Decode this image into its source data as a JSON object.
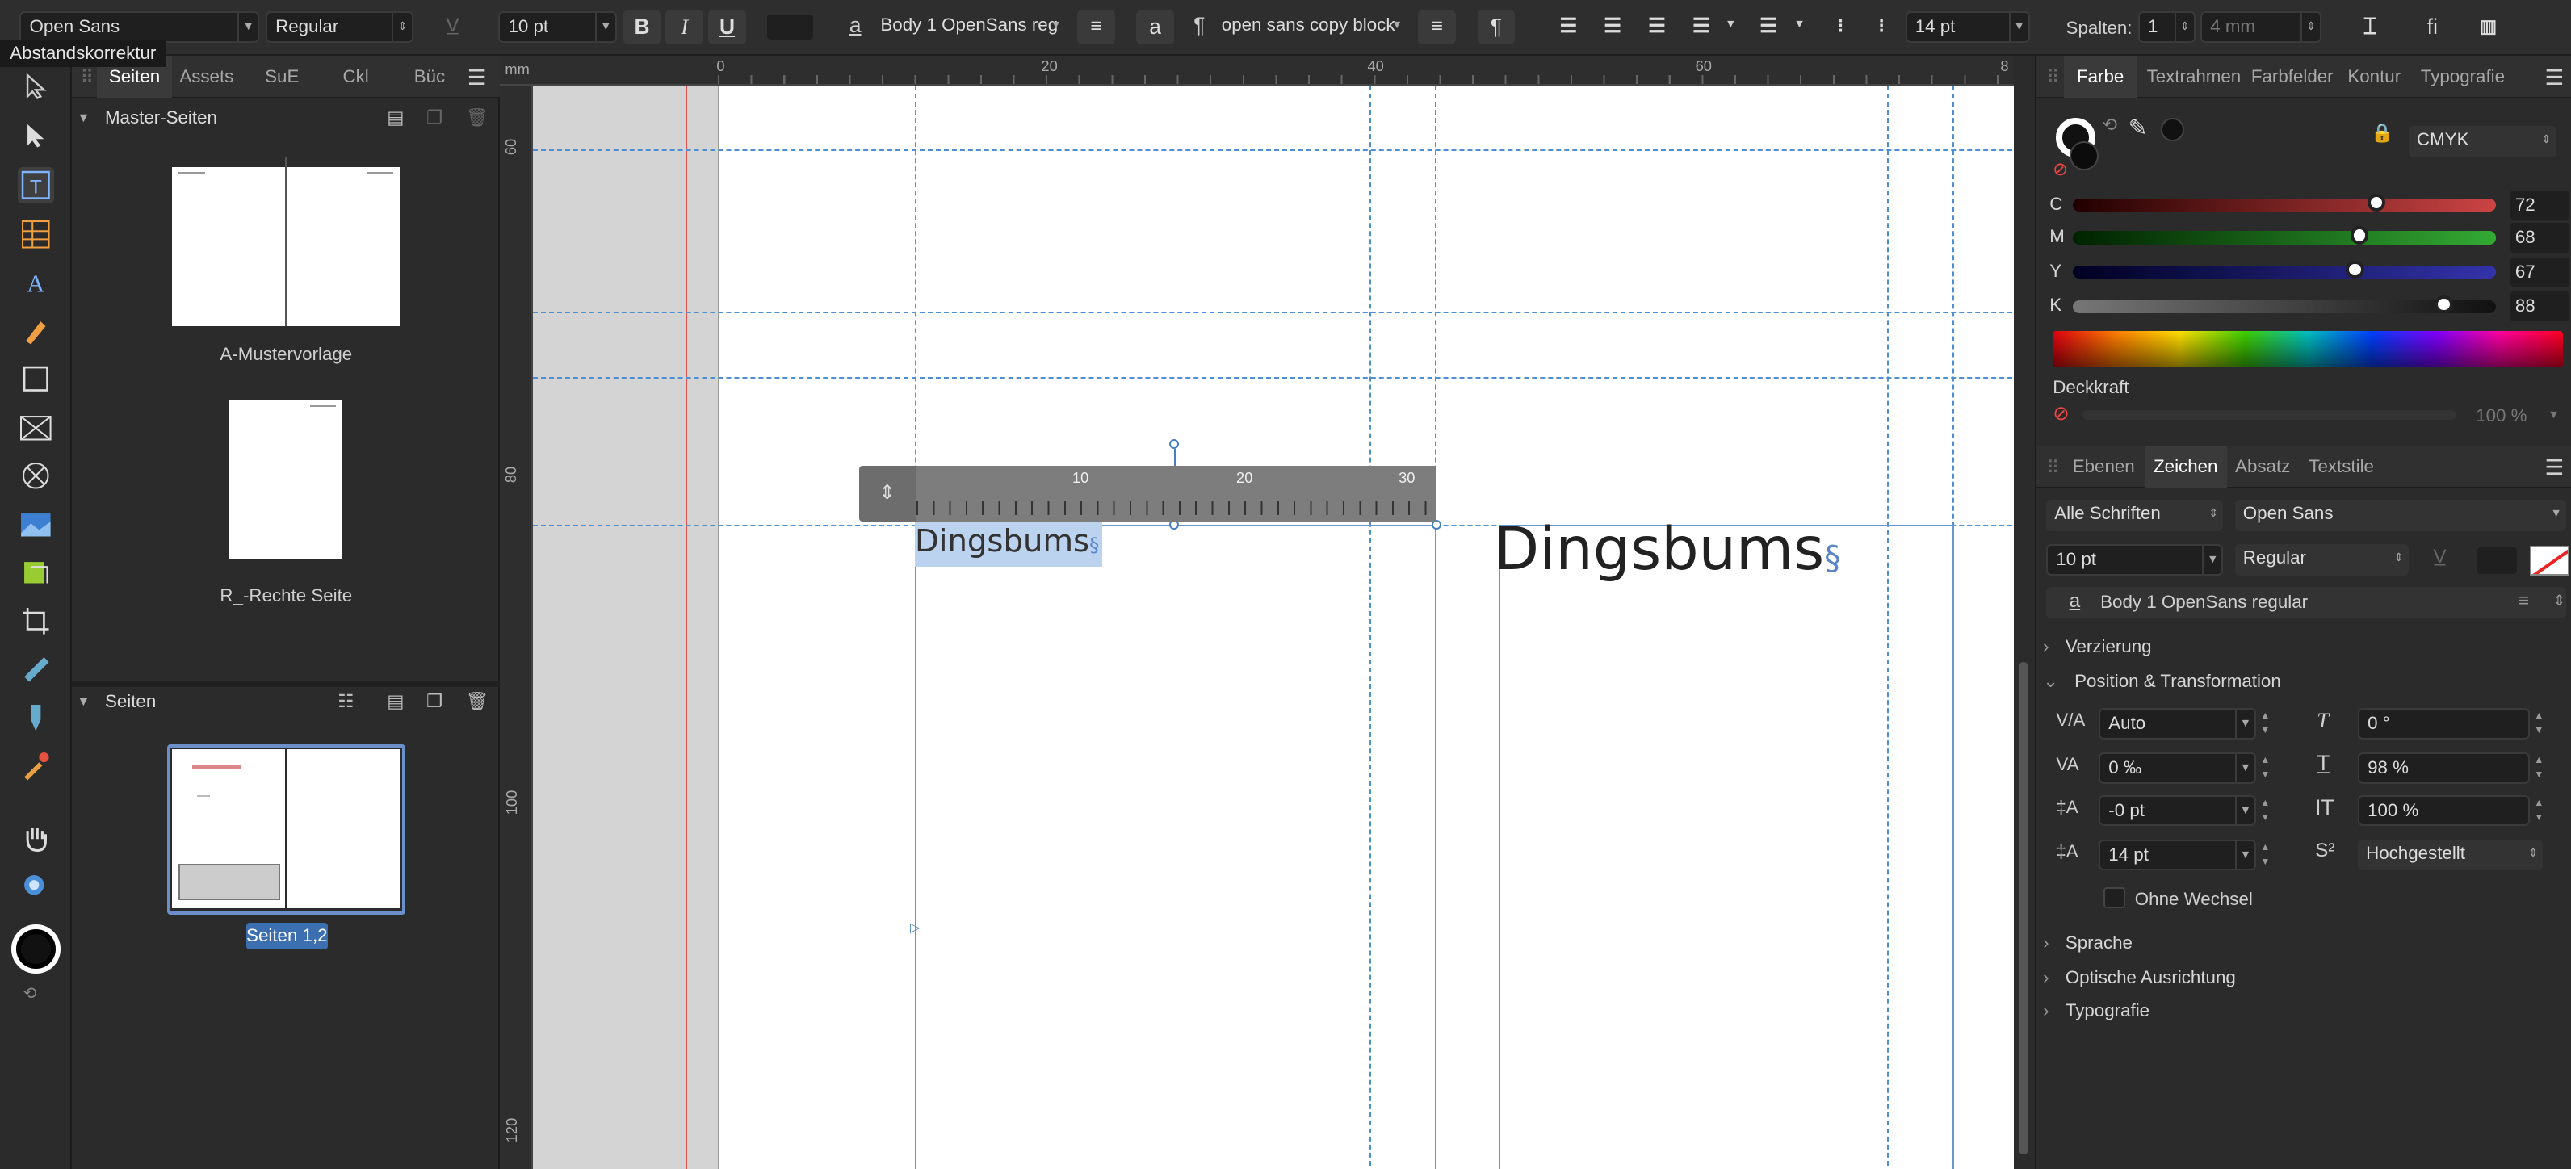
{
  "toolbar": {
    "font_family": "Open Sans",
    "font_style": "Regular",
    "font_size": "10 pt",
    "bold": "B",
    "italic": "I",
    "underline": "U",
    "char_style": "Body 1 OpenSans reg",
    "para_style": "open sans copy block",
    "a_label": "a",
    "pilcrow": "¶",
    "leading": "14 pt",
    "columns_label": "Spalten:",
    "columns_value": "1",
    "gutter": "4 mm",
    "fi_label": "fi"
  },
  "tooltip": "Abstandskorrektur",
  "left_panel": {
    "tabs": [
      "Seiten",
      "Assets",
      "SuE",
      "Ckl",
      "Büc"
    ],
    "master_header": "Master-Seiten",
    "masters": [
      "A-Mustervorlage",
      "R_-Rechte Seite"
    ],
    "pages_header": "Seiten",
    "spread_label": "Seiten 1,2"
  },
  "ruler": {
    "unit": "mm",
    "top_ticks": [
      "0",
      "20",
      "40",
      "60",
      "8"
    ],
    "side_ticks": [
      "60",
      "80",
      "100",
      "120"
    ],
    "text_ruler_ticks": [
      "10",
      "20",
      "30"
    ]
  },
  "canvas": {
    "frame1_text": "Dingsbums",
    "frame2_text": "Dingsbums",
    "pilcrow": "§"
  },
  "right_top": {
    "tabs": [
      "Farbe",
      "Textrahmen",
      "Farbfelder",
      "Kontur",
      "Typografie"
    ],
    "color_model": "CMYK",
    "channels": [
      {
        "name": "C",
        "value": "72",
        "level": 0.72
      },
      {
        "name": "M",
        "value": "68",
        "level": 0.68
      },
      {
        "name": "Y",
        "value": "67",
        "level": 0.67
      },
      {
        "name": "K",
        "value": "88",
        "level": 0.88
      }
    ],
    "opacity_label": "Deckkraft",
    "opacity_value": "100 %"
  },
  "right_bottom": {
    "tabs": [
      "Ebenen",
      "Zeichen",
      "Absatz",
      "Textstile"
    ],
    "font_collection": "Alle Schriften",
    "font_family": "Open Sans",
    "font_size": "10 pt",
    "font_style": "Regular",
    "char_style": "Body 1 OpenSans regular",
    "sections": [
      "Verzierung",
      "Position & Transformation",
      "Sprache",
      "Optische Ausrichtung",
      "Typografie"
    ],
    "kerning": "Auto",
    "tracking": "0 ‰",
    "baseline": "-0 pt",
    "leading": "14 pt",
    "shear": "0 °",
    "vscale": "98 %",
    "hscale": "100 %",
    "position": "Hochgestellt",
    "no_break": "Ohne Wechsel"
  }
}
